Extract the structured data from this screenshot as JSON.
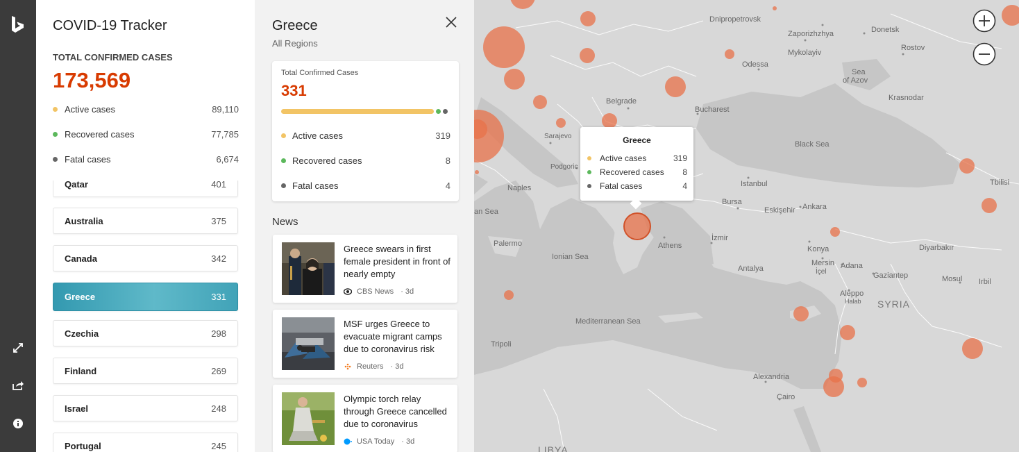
{
  "app": {
    "title": "COVID-19 Tracker",
    "total_label": "TOTAL CONFIRMED CASES",
    "total_value": "173,569",
    "stats": [
      {
        "label": "Active cases",
        "value": "89,110",
        "color": "#f2c465"
      },
      {
        "label": "Recovered cases",
        "value": "77,785",
        "color": "#5cb85c"
      },
      {
        "label": "Fatal cases",
        "value": "6,674",
        "color": "#666666"
      }
    ],
    "countries": [
      {
        "name": "Qatar",
        "value": "401"
      },
      {
        "name": "Australia",
        "value": "375"
      },
      {
        "name": "Canada",
        "value": "342"
      },
      {
        "name": "Greece",
        "value": "331"
      },
      {
        "name": "Czechia",
        "value": "298"
      },
      {
        "name": "Finland",
        "value": "269"
      },
      {
        "name": "Israel",
        "value": "248"
      },
      {
        "name": "Portugal",
        "value": "245"
      }
    ],
    "selected_country": "Greece"
  },
  "rail": {
    "logo_icon": "bing-logo-icon",
    "buttons": [
      "expand-icon",
      "share-icon",
      "info-icon"
    ]
  },
  "detail": {
    "country": "Greece",
    "region": "All Regions",
    "card_title": "Total Confirmed Cases",
    "card_value": "331",
    "stats": [
      {
        "label": "Active cases",
        "value": "319",
        "color": "#f2c465"
      },
      {
        "label": "Recovered cases",
        "value": "8",
        "color": "#5cb85c"
      },
      {
        "label": "Fatal cases",
        "value": "4",
        "color": "#666666"
      }
    ],
    "news_heading": "News",
    "news": [
      {
        "headline": "Greece swears in first female president in front of nearly empty",
        "source": "CBS News",
        "age": "3d",
        "source_icon": "cbs-eye-icon"
      },
      {
        "headline": "MSF urges Greece to evacuate migrant camps due to coronavirus risk",
        "source": "Reuters",
        "age": "3d",
        "source_icon": "reuters-icon"
      },
      {
        "headline": "Olympic torch relay through Greece cancelled due to coronavirus",
        "source": "USA Today",
        "age": "3d",
        "source_icon": "usa-today-icon"
      }
    ]
  },
  "map": {
    "labels": {
      "dnipropetrovsk": "Dnipropetrovsk",
      "zaporizhzhya": "Zaporizhzhya",
      "donetsk": "Donetsk",
      "mykolayiv": "Mykolayiv",
      "rostov": "Rostov",
      "odessa": "Odessa",
      "sea_of_azov_1": "Sea",
      "sea_of_azov_2": "of Azov",
      "krasnodar": "Krasnodar",
      "belgrade": "Belgrade",
      "bucharest": "Bucharest",
      "sarajevo": "Sarajevo",
      "black_sea": "Black Sea",
      "podgorica": "Podgoric",
      "naples": "Naples",
      "istanbul": "Istanbul",
      "tbilisi": "Tbilisi",
      "bursa": "Bursa",
      "eskisehir": "Eskişehir",
      "ankara": "Ankara",
      "sea_left": "an Sea",
      "izmir": "İzmir",
      "palermo": "Palermo",
      "athens": "Athens",
      "konya": "Konya",
      "diyarbakir": "Diyarbakır",
      "ionian_sea": "Ionian Sea",
      "antalya": "Antalya",
      "mersin": "Mersin",
      "icel": "İçel",
      "adana": "Adana",
      "gaziantep": "Gaziantep",
      "mosul": "Mosul",
      "erbil": "Irbil",
      "aleppo": "Aleppo",
      "halab": "Halab",
      "syria": "SYRIA",
      "mediterranean": "Mediterranean Sea",
      "tripoli": "Tripoli",
      "alexandria": "Alexandria",
      "cairo": "Cairo",
      "libya": "LIBYA"
    },
    "popup": {
      "title": "Greece",
      "stats": [
        {
          "label": "Active cases",
          "value": "319",
          "color": "#f2c465"
        },
        {
          "label": "Recovered cases",
          "value": "8",
          "color": "#5cb85c"
        },
        {
          "label": "Fatal cases",
          "value": "4",
          "color": "#666666"
        }
      ]
    },
    "zoom_in_icon": "zoom-in-icon",
    "zoom_out_icon": "zoom-out-icon",
    "bubble_color": "#e8714a"
  }
}
